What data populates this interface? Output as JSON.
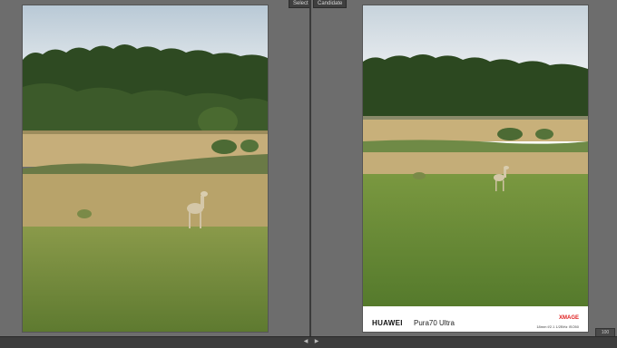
{
  "panes": {
    "left_label": "Select",
    "right_label": "Candidate"
  },
  "watermark": {
    "brand": "HUAWEI",
    "model": "Pura70 Ultra",
    "xmage": "XMAGE",
    "exif": "18mm f/2.1 1/2BHz ISO50"
  },
  "corner_badge": "100",
  "colors": {
    "sky": "#c9d6df",
    "trees": "#2f4a25",
    "field_dry": "#c8b07a",
    "grass": "#6d8a3c",
    "xmage_red": "#e02020"
  },
  "icons": {
    "left_arrow": "triangle-left-icon",
    "right_arrow": "triangle-right-icon"
  }
}
